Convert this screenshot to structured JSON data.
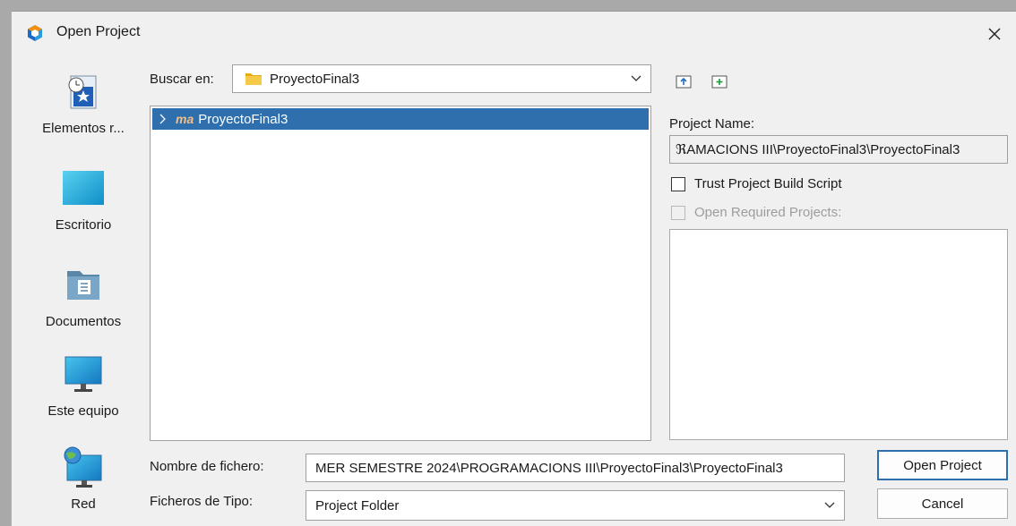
{
  "window": {
    "title": "Open Project"
  },
  "places": [
    {
      "label": "Elementos r...",
      "icon": "recent-items-icon"
    },
    {
      "label": "Escritorio",
      "icon": "desktop-icon"
    },
    {
      "label": "Documentos",
      "icon": "documents-folder-icon"
    },
    {
      "label": "Este equipo",
      "icon": "computer-icon"
    },
    {
      "label": "Red",
      "icon": "network-icon"
    }
  ],
  "look_in": {
    "label": "Buscar en:",
    "value": "ProyectoFinal3"
  },
  "toolbar": {
    "up_icon": "folder-up-icon",
    "new_folder_icon": "new-folder-icon"
  },
  "tree": {
    "items": [
      {
        "label": "ProyectoFinal3",
        "badge": "ma"
      }
    ]
  },
  "project": {
    "name_label": "Project Name:",
    "name_value": "ℜAMACIONS III\\ProyectoFinal3\\ProyectoFinal3",
    "trust_label": "Trust Project Build Script",
    "required_label": "Open Required Projects:"
  },
  "file_name": {
    "label": "Nombre de fichero:",
    "value": "MER SEMESTRE 2024\\PROGRAMACIONS III\\ProyectoFinal3\\ProyectoFinal3"
  },
  "file_type": {
    "label": "Ficheros de Tipo:",
    "value": "Project Folder"
  },
  "buttons": {
    "open": "Open Project",
    "cancel": "Cancel"
  },
  "colors": {
    "selection": "#2f6fad",
    "folder": "#f4c430",
    "dialog_bg": "#f0f0f0"
  }
}
